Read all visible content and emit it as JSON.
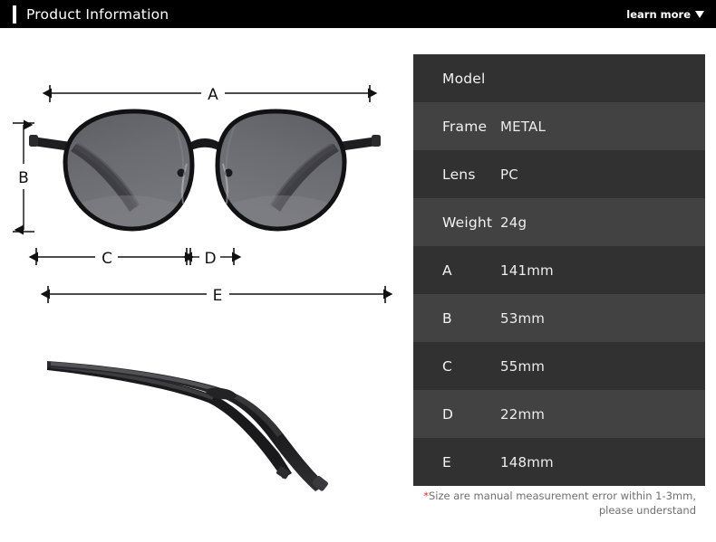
{
  "header": {
    "title": "Product Information",
    "learn_more_label": "learn more",
    "caret_icon": "chevron-down-icon",
    "background": "#000000",
    "accent_color": "#ffffff"
  },
  "diagram": {
    "front_view_alt": "sunglasses-front-view",
    "side_view_alt": "sunglasses-temple-side-view",
    "measurements": [
      {
        "key": "A",
        "label": "A",
        "orientation": "horizontal",
        "view": "front-top"
      },
      {
        "key": "B",
        "label": "B",
        "orientation": "vertical",
        "view": "front-left"
      },
      {
        "key": "C",
        "label": "C",
        "orientation": "horizontal",
        "view": "front-bottom-left"
      },
      {
        "key": "D",
        "label": "D",
        "orientation": "horizontal",
        "view": "front-bottom-right"
      },
      {
        "key": "E",
        "label": "E",
        "orientation": "horizontal",
        "view": "side-top"
      }
    ],
    "colors": {
      "frame": "#1b1b1d",
      "lens": "#67686d",
      "arrow": "#111111"
    }
  },
  "spec_table": {
    "row_color_odd": "#313131",
    "row_color_even": "#424242",
    "rows": [
      {
        "label": "Model",
        "value": ""
      },
      {
        "label": "Frame",
        "value": "METAL"
      },
      {
        "label": "Lens",
        "value": "PC"
      },
      {
        "label": "Weight",
        "value": "24g"
      },
      {
        "label": "A",
        "value": "141mm"
      },
      {
        "label": "B",
        "value": "53mm"
      },
      {
        "label": "C",
        "value": "55mm"
      },
      {
        "label": "D",
        "value": "22mm"
      },
      {
        "label": "E",
        "value": "148mm"
      }
    ],
    "note": {
      "asterisk": "*",
      "line1": "Size are manual measurement error within 1-3mm,",
      "line2": "please understand",
      "asterisk_color": "#d8322e"
    }
  }
}
